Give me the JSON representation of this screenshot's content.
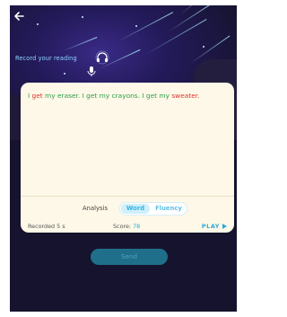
{
  "header": {
    "back_icon": "arrow-left-icon",
    "record_label": "Record your reading",
    "headphone_icon": "headphone-icon",
    "mic_icon": "microphone-icon"
  },
  "reading": {
    "words": [
      {
        "text": "I",
        "status": "correct"
      },
      {
        "text": "get",
        "status": "incorrect"
      },
      {
        "text": "my",
        "status": "correct"
      },
      {
        "text": "eraser.",
        "status": "correct"
      },
      {
        "text": "I",
        "status": "correct"
      },
      {
        "text": "get",
        "status": "correct"
      },
      {
        "text": "my",
        "status": "correct"
      },
      {
        "text": "crayons.",
        "status": "correct"
      },
      {
        "text": "I",
        "status": "correct"
      },
      {
        "text": "get",
        "status": "correct"
      },
      {
        "text": "my",
        "status": "correct"
      },
      {
        "text": "sweater.",
        "status": "incorrect"
      }
    ]
  },
  "analysis": {
    "label": "Analysis",
    "tabs": [
      {
        "label": "Word",
        "selected": true
      },
      {
        "label": "Fluency",
        "selected": false
      }
    ]
  },
  "footer": {
    "recorded": "Recorded 5 s",
    "score_label": "Score:",
    "score_value": "78",
    "play_label": "PLAY"
  },
  "send": {
    "label": "Send"
  },
  "colors": {
    "correct": "#2e9e4a",
    "incorrect": "#d93434",
    "accent": "#2ba8d6",
    "card": "#fdf8e7",
    "background": "#16132e"
  }
}
